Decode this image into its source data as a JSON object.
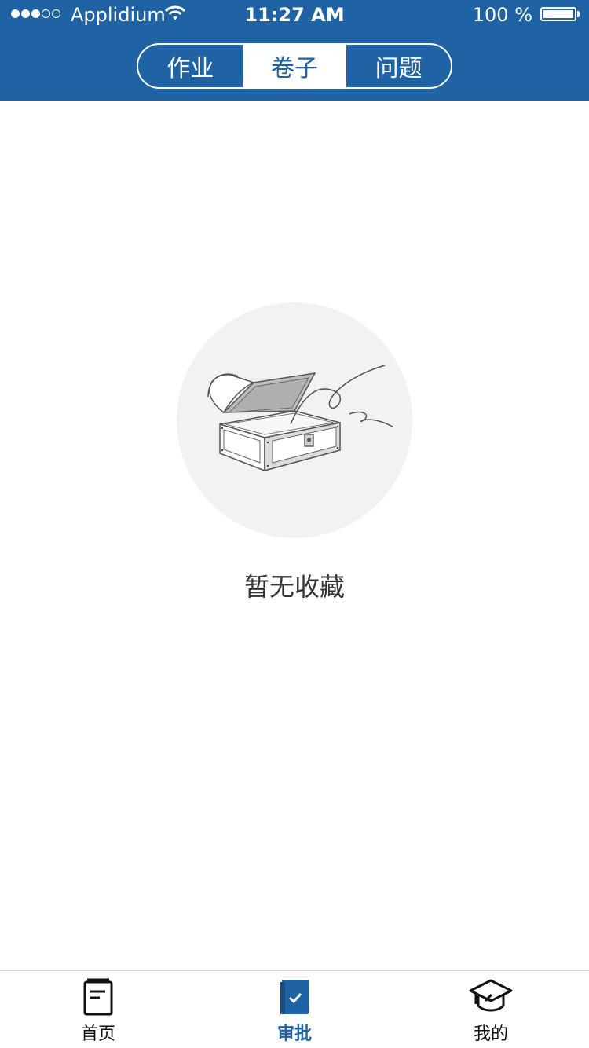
{
  "status_bar": {
    "carrier": "Applidium",
    "time": "11:27 AM",
    "battery": "100 %",
    "signal_full_dots": 3,
    "signal_empty_dots": 2
  },
  "segmented": {
    "items": [
      {
        "label": "作业",
        "selected": false
      },
      {
        "label": "卷子",
        "selected": true
      },
      {
        "label": "问题",
        "selected": false
      }
    ]
  },
  "empty_state": {
    "icon": "treasure-chest-icon",
    "message": "暂无收藏"
  },
  "tabbar": {
    "items": [
      {
        "label": "首页",
        "icon": "document-icon",
        "active": false
      },
      {
        "label": "审批",
        "icon": "approval-book-icon",
        "active": true
      },
      {
        "label": "我的",
        "icon": "graduation-cap-icon",
        "active": false
      }
    ]
  },
  "colors": {
    "brand_blue": "#2063a5",
    "empty_circle": "#f2f2f2"
  }
}
